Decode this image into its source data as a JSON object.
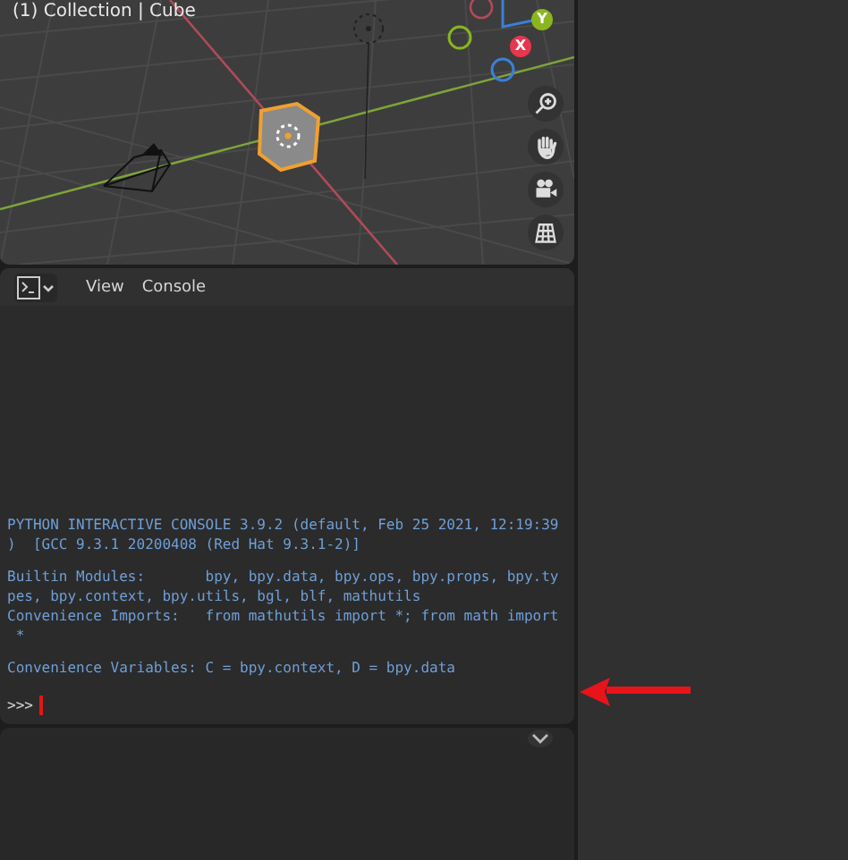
{
  "viewport": {
    "title": "(1) Collection | Cube",
    "gizmo": {
      "y_label": "Y",
      "x_label": "X"
    }
  },
  "console_header": {
    "menus": [
      {
        "label": "View"
      },
      {
        "label": "Console"
      }
    ]
  },
  "console": {
    "blocks": [
      [
        "PYTHON INTERACTIVE CONSOLE 3.9.2 (default, Feb 25 2021, 12:19:39",
        ")  [GCC 9.3.1 20200408 (Red Hat 9.3.1-2)]"
      ],
      [
        "Builtin Modules:       bpy, bpy.data, bpy.ops, bpy.props, bpy.ty",
        "pes, bpy.context, bpy.utils, bgl, blf, mathutils",
        "Convenience Imports:   from mathutils import *; from math import",
        " *"
      ],
      [
        "Convenience Variables: C = bpy.context, D = bpy.data"
      ]
    ],
    "prompt": ">>>"
  }
}
